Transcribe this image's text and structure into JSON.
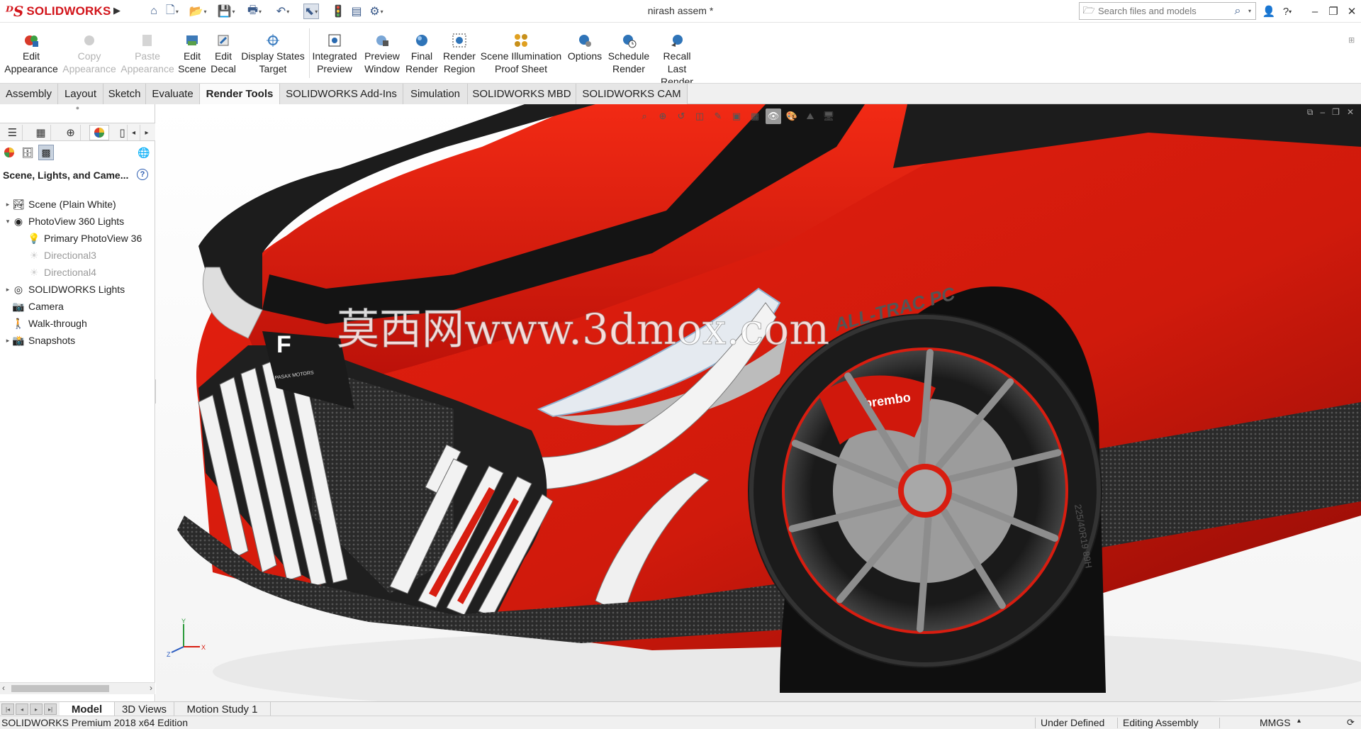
{
  "app": {
    "brand": "SOLIDWORKS",
    "document_title": "nirash assem *"
  },
  "search": {
    "placeholder": "Search files and models"
  },
  "ribbon": {
    "buttons": [
      {
        "label1": "Edit",
        "label2": "Appearance",
        "enabled": true
      },
      {
        "label1": "Copy",
        "label2": "Appearance",
        "enabled": false
      },
      {
        "label1": "Paste",
        "label2": "Appearance",
        "enabled": false
      },
      {
        "label1": "Edit",
        "label2": "Scene",
        "enabled": true
      },
      {
        "label1": "Edit",
        "label2": "Decal",
        "enabled": true
      },
      {
        "label1": "Display States",
        "label2": "Target",
        "enabled": true
      },
      {
        "label1": "Integrated",
        "label2": "Preview",
        "enabled": true
      },
      {
        "label1": "Preview",
        "label2": "Window",
        "enabled": true
      },
      {
        "label1": "Final",
        "label2": "Render",
        "enabled": true
      },
      {
        "label1": "Render",
        "label2": "Region",
        "enabled": true
      },
      {
        "label1": "Scene Illumination",
        "label2": "Proof Sheet",
        "enabled": true
      },
      {
        "label1": "Options",
        "label2": "",
        "enabled": true
      },
      {
        "label1": "Schedule",
        "label2": "Render",
        "enabled": true
      },
      {
        "label1": "Recall Last",
        "label2": "Render",
        "enabled": true
      }
    ]
  },
  "command_tabs": [
    "Assembly",
    "Layout",
    "Sketch",
    "Evaluate",
    "Render Tools",
    "SOLIDWORKS Add-Ins",
    "Simulation",
    "SOLIDWORKS MBD",
    "SOLIDWORKS CAM"
  ],
  "active_command_tab": "Render Tools",
  "left_pane": {
    "header": "Scene, Lights, and Came...",
    "help": "?",
    "tree": [
      {
        "label": "Scene (Plain White)",
        "level": 0,
        "toggle": "▸",
        "icon": "scene-icon",
        "dim": false
      },
      {
        "label": "PhotoView 360 Lights",
        "level": 0,
        "toggle": "▾",
        "icon": "photoview-lights-icon",
        "dim": false
      },
      {
        "label": "Primary PhotoView 36",
        "level": 1,
        "toggle": "",
        "icon": "light-icon",
        "dim": false
      },
      {
        "label": "Directional3",
        "level": 1,
        "toggle": "",
        "icon": "directional-light-icon",
        "dim": true
      },
      {
        "label": "Directional4",
        "level": 1,
        "toggle": "",
        "icon": "directional-light-icon",
        "dim": true
      },
      {
        "label": "SOLIDWORKS Lights",
        "level": 0,
        "toggle": "▸",
        "icon": "solidworks-lights-icon",
        "dim": false
      },
      {
        "label": "Camera",
        "level": 0,
        "toggle": "",
        "icon": "camera-icon",
        "dim": false
      },
      {
        "label": "Walk-through",
        "level": 0,
        "toggle": "",
        "icon": "walkthrough-icon",
        "dim": false
      },
      {
        "label": "Snapshots",
        "level": 0,
        "toggle": "▸",
        "icon": "snapshots-icon",
        "dim": false
      }
    ]
  },
  "viewport": {
    "watermark": "莫西网www.3dmox.com",
    "car_badge": "PASAX MOTORS",
    "brake_caliper_text": "brembo",
    "tire_text": "ALL-TRAC PC",
    "tire_size": "225/40R19 89H",
    "triad": {
      "x": "X",
      "y": "Y",
      "z": "Z"
    }
  },
  "bottom_tabs": [
    "Model",
    "3D Views",
    "Motion Study 1"
  ],
  "active_bottom_tab": "Model",
  "status": {
    "edition": "SOLIDWORKS Premium 2018 x64 Edition",
    "state": "Under Defined",
    "mode": "Editing Assembly",
    "units": "MMGS"
  },
  "colors": {
    "brand_red": "#d2141a",
    "car_red": "#e0190f",
    "accent_blue": "#3a5a8a"
  }
}
